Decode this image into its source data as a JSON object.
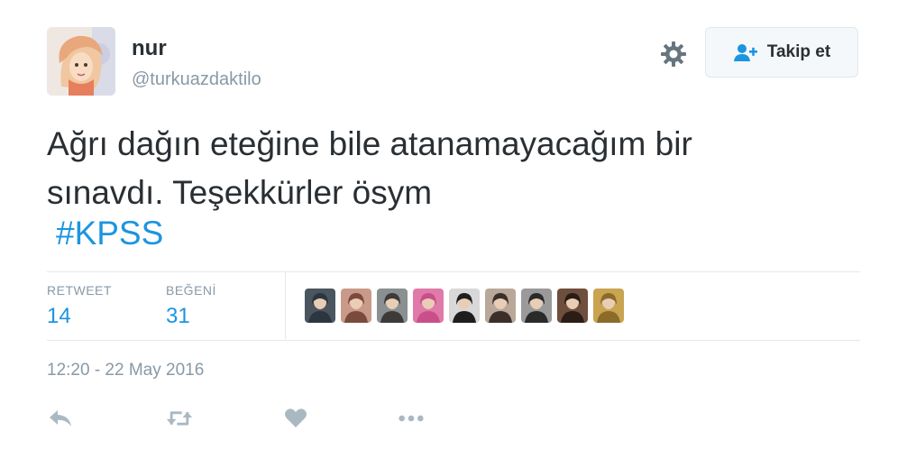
{
  "user": {
    "name": "nur",
    "handle": "@turkuazdaktilo"
  },
  "follow_button": {
    "label": "Takip et"
  },
  "tweet": {
    "text_line1": "Ağrı dağın eteğine bile atanamayacağım bir",
    "text_line2": "sınavdı. Teşekkürler ösym",
    "hashtag": "#KPSS"
  },
  "stats": {
    "retweet_label": "RETWEET",
    "retweet_count": "14",
    "like_label": "BEĞENİ",
    "like_count": "31"
  },
  "likers": [
    {
      "name": "liker-1",
      "bg": "#4a5560",
      "fg": "#2c3640"
    },
    {
      "name": "liker-2",
      "bg": "#c99a8a",
      "fg": "#7a4b3d"
    },
    {
      "name": "liker-3",
      "bg": "#8a8f92",
      "fg": "#3d3a38"
    },
    {
      "name": "liker-4",
      "bg": "#e07aa8",
      "fg": "#c94f8b"
    },
    {
      "name": "liker-5",
      "bg": "#d8d8d8",
      "fg": "#1e1e1e"
    },
    {
      "name": "liker-6",
      "bg": "#b9a89a",
      "fg": "#3b2f29"
    },
    {
      "name": "liker-7",
      "bg": "#9a9a9a",
      "fg": "#2a2a2a"
    },
    {
      "name": "liker-8",
      "bg": "#6e4e3c",
      "fg": "#2b1c15"
    },
    {
      "name": "liker-9",
      "bg": "#c9a451",
      "fg": "#8c6b2a"
    }
  ],
  "timestamp": "12:20 - 22 May 2016",
  "colors": {
    "link": "#1b95e0",
    "muted": "#8899a6",
    "text": "#292f33",
    "icon": "#aab8c2"
  },
  "icons": [
    "gear-icon",
    "follow-user-icon",
    "reply-icon",
    "retweet-icon",
    "like-icon",
    "more-icon"
  ]
}
